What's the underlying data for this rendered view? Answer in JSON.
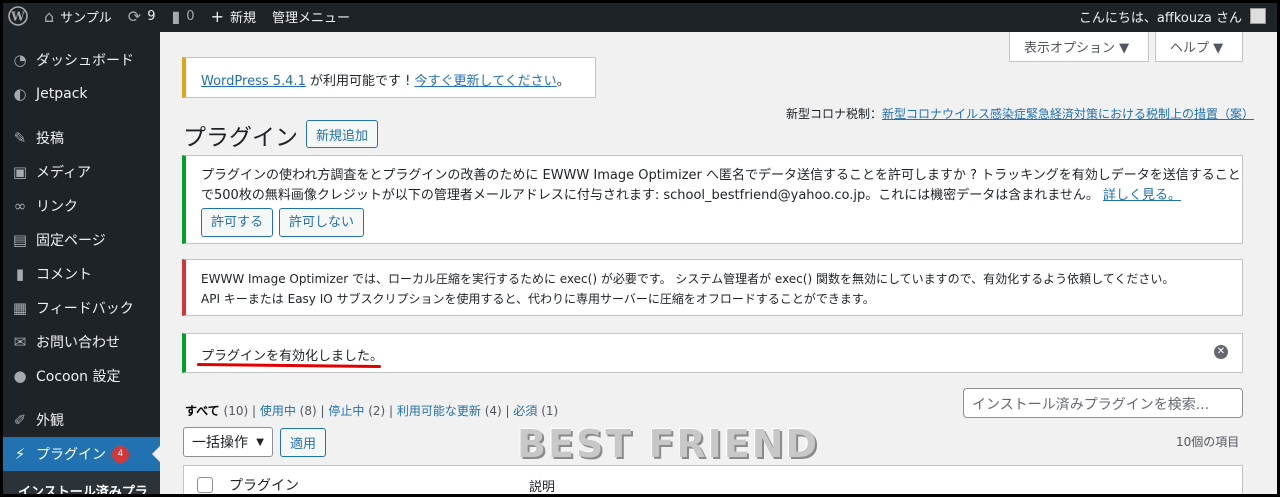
{
  "adminbar": {
    "site_name": "サンプル",
    "updates_count": "9",
    "comments_count": "0",
    "new_label": "新規",
    "admin_menu_label": "管理メニュー",
    "greeting": "こんにちは、affkouza さん"
  },
  "sidebar": {
    "items": [
      {
        "label": "ダッシュボード",
        "icon": "dashboard-icon"
      },
      {
        "label": "Jetpack",
        "icon": "jetpack-icon"
      },
      {
        "label": "投稿",
        "icon": "pin-icon"
      },
      {
        "label": "メディア",
        "icon": "media-icon"
      },
      {
        "label": "リンク",
        "icon": "link-icon"
      },
      {
        "label": "固定ページ",
        "icon": "page-icon"
      },
      {
        "label": "コメント",
        "icon": "comment-icon"
      },
      {
        "label": "フィードバック",
        "icon": "feedback-icon"
      },
      {
        "label": "お問い合わせ",
        "icon": "mail-icon"
      },
      {
        "label": "Cocoon 設定",
        "icon": "cocoon-icon"
      },
      {
        "label": "外観",
        "icon": "brush-icon"
      },
      {
        "label": "プラグイン",
        "icon": "plugin-icon",
        "badge": "4"
      }
    ],
    "submenu_head": "インストール済みプラ"
  },
  "screen_options": "表示オプション ▼",
  "help": "ヘルプ ▼",
  "update_notice": {
    "link": "WordPress 5.4.1",
    "text": " が利用可能です ! ",
    "update_link": "今すぐ更新してください",
    "suffix": "。"
  },
  "covid_notice": {
    "prefix": "新型コロナ税制：",
    "link": "新型コロナウイルス感染症緊急経済対策における税制上の措置（案）"
  },
  "page_title": "プラグイン",
  "add_new": "新規追加",
  "ewww_tracking": {
    "line1": "プラグインの使われ方調査をとプラグインの改善のために EWWW Image Optimizer へ匿名でデータ送信することを許可しますか ? トラッキングを有効しデータを送信すること",
    "line2": "で500枚の無料画像クレジットが以下の管理者メールアドレスに付与されます: school_bestfriend@yahoo.co.jp。これには機密データは含まれません。",
    "more_link": "詳しく見る。",
    "allow": "許可する",
    "deny": "許可しない"
  },
  "ewww_exec": {
    "line1": "EWWW Image Optimizer では、ローカル圧縮を実行するために exec() が必要です。 システム管理者が exec() 関数を無効にしていますので、有効化するよう依頼してください。",
    "line2": "API キーまたは Easy IO サブスクリプションを使用すると、代わりに専用サーバーに圧縮をオフロードすることができます。"
  },
  "activated_notice": "プラグインを有効化しました。",
  "filters": {
    "all": "すべて",
    "all_count": "(10)",
    "active": "使用中",
    "active_count": "(8)",
    "inactive": "停止中",
    "inactive_count": "(2)",
    "updates": "利用可能な更新",
    "updates_count": "(4)",
    "required": "必須",
    "required_count": "(1)"
  },
  "search_placeholder": "インストール済みプラグインを検索...",
  "bulk_action": "一括操作",
  "apply": "適用",
  "watermark": "BEST FRIEND",
  "items_count": "10個の項目",
  "table": {
    "col_plugin": "プラグイン",
    "col_desc": "説明"
  },
  "colors": {
    "accent": "#2271b1",
    "success": "#00a32a",
    "error": "#d63638",
    "warning": "#dba617",
    "underline": "#e00000"
  }
}
